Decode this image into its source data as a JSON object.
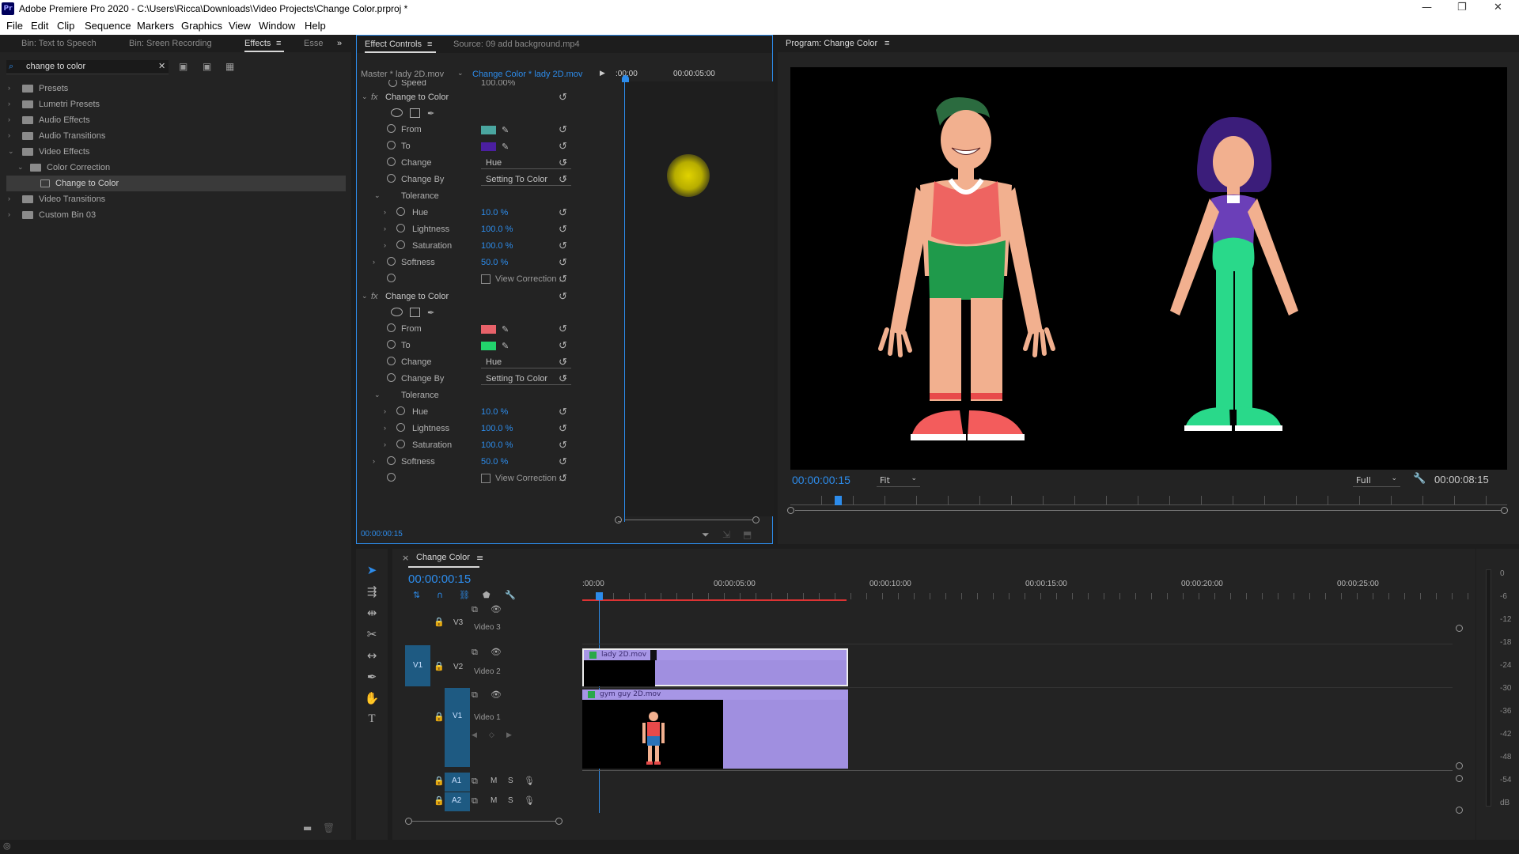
{
  "window": {
    "title": "Adobe Premiere Pro 2020 - C:\\Users\\Ricca\\Downloads\\Video Projects\\Change Color.prproj *",
    "logo": "Pr",
    "controls": [
      "—",
      "❐",
      "✕"
    ]
  },
  "menu": [
    "File",
    "Edit",
    "Clip",
    "Sequence",
    "Markers",
    "Graphics",
    "View",
    "Window",
    "Help"
  ],
  "effects_panel": {
    "tabs": [
      "Bin: Text to Speech",
      "Bin: Sreen Recording",
      "Effects",
      "Esse"
    ],
    "search_value": "change to color",
    "tree": [
      {
        "label": "Presets",
        "level": 0,
        "open": false
      },
      {
        "label": "Lumetri Presets",
        "level": 0,
        "open": false
      },
      {
        "label": "Audio Effects",
        "level": 0,
        "open": false
      },
      {
        "label": "Audio Transitions",
        "level": 0,
        "open": false
      },
      {
        "label": "Video Effects",
        "level": 0,
        "open": true
      },
      {
        "label": "Color Correction",
        "level": 1,
        "open": true
      },
      {
        "label": "Change to Color",
        "level": 2,
        "open": false,
        "selected": true
      },
      {
        "label": "Video Transitions",
        "level": 0,
        "open": false
      },
      {
        "label": "Custom Bin 03",
        "level": 0,
        "open": false
      }
    ]
  },
  "effect_controls": {
    "tabs": [
      "Effect Controls",
      "Source: 09 add background.mp4"
    ],
    "master": "Master * lady 2D.mov",
    "clip": "Change Color * lady 2D.mov",
    "time_a": ":00:00",
    "time_b": "00:00:05:00",
    "speed_label": "Speed",
    "speed_value": "100.00%",
    "footer_time": "00:00:00:15",
    "effects": [
      {
        "name": "Change to Color",
        "from_label": "From",
        "from_color": "#4aa6a0",
        "to_label": "To",
        "to_color": "#4b1fa0",
        "change_label": "Change",
        "change_value": "Hue",
        "changeby_label": "Change By",
        "changeby_value": "Setting To Color",
        "tolerance_label": "Tolerance",
        "hue_label": "Hue",
        "hue_value": "10.0 %",
        "lightness_label": "Lightness",
        "lightness_value": "100.0 %",
        "saturation_label": "Saturation",
        "saturation_value": "100.0 %",
        "softness_label": "Softness",
        "softness_value": "50.0 %",
        "view_label": "View Correction ..."
      },
      {
        "name": "Change to Color",
        "from_label": "From",
        "from_color": "#e8626a",
        "to_label": "To",
        "to_color": "#22d36c",
        "change_label": "Change",
        "change_value": "Hue",
        "changeby_label": "Change By",
        "changeby_value": "Setting To Color",
        "tolerance_label": "Tolerance",
        "hue_label": "Hue",
        "hue_value": "10.0 %",
        "lightness_label": "Lightness",
        "lightness_value": "100.0 %",
        "saturation_label": "Saturation",
        "saturation_value": "100.0 %",
        "softness_label": "Softness",
        "softness_value": "50.0 %",
        "view_label": "View Correction ..."
      }
    ]
  },
  "program_monitor": {
    "title": "Program: Change Color",
    "timecode": "00:00:00:15",
    "fit": "Fit",
    "quality": "Full",
    "duration": "00:00:08:15"
  },
  "timeline": {
    "sequence": "Change Color",
    "timecode": "00:00:00:15",
    "ruler": [
      ":00:00",
      "00:00:05:00",
      "00:00:10:00",
      "00:00:15:00",
      "00:00:20:00",
      "00:00:25:00"
    ],
    "tracks": {
      "v3": "V3",
      "v3_name": "Video 3",
      "v2": "V2",
      "v2_name": "Video 2",
      "v1": "V1",
      "v1_name": "Video 1",
      "v1_src": "V1",
      "a1": "A1",
      "a2": "A2",
      "m": "M",
      "s": "S"
    },
    "clips": {
      "lady": "lady 2D.mov",
      "guy": "gym guy 2D.mov"
    }
  },
  "meters": [
    "0",
    "-6",
    "-12",
    "-18",
    "-24",
    "-30",
    "-36",
    "-42",
    "-48",
    "-54",
    "dB"
  ],
  "colors": {
    "accent": "#2d8ceb",
    "clip": "#a08fe0",
    "playhead": "#2d8ceb",
    "work_area": "#d33"
  },
  "icons": [
    "search-icon",
    "clear-icon",
    "stopwatch-icon",
    "reset-icon",
    "eyedropper-icon",
    "pen-icon",
    "ellipse-mask-icon",
    "rect-mask-icon",
    "play-icon",
    "step-back-icon",
    "step-forward-icon",
    "marker-icon",
    "camera-icon",
    "wrench-icon",
    "eye-icon",
    "lock-icon",
    "mic-icon",
    "selection-tool-icon",
    "razor-tool-icon",
    "hand-tool-icon",
    "type-tool-icon"
  ]
}
